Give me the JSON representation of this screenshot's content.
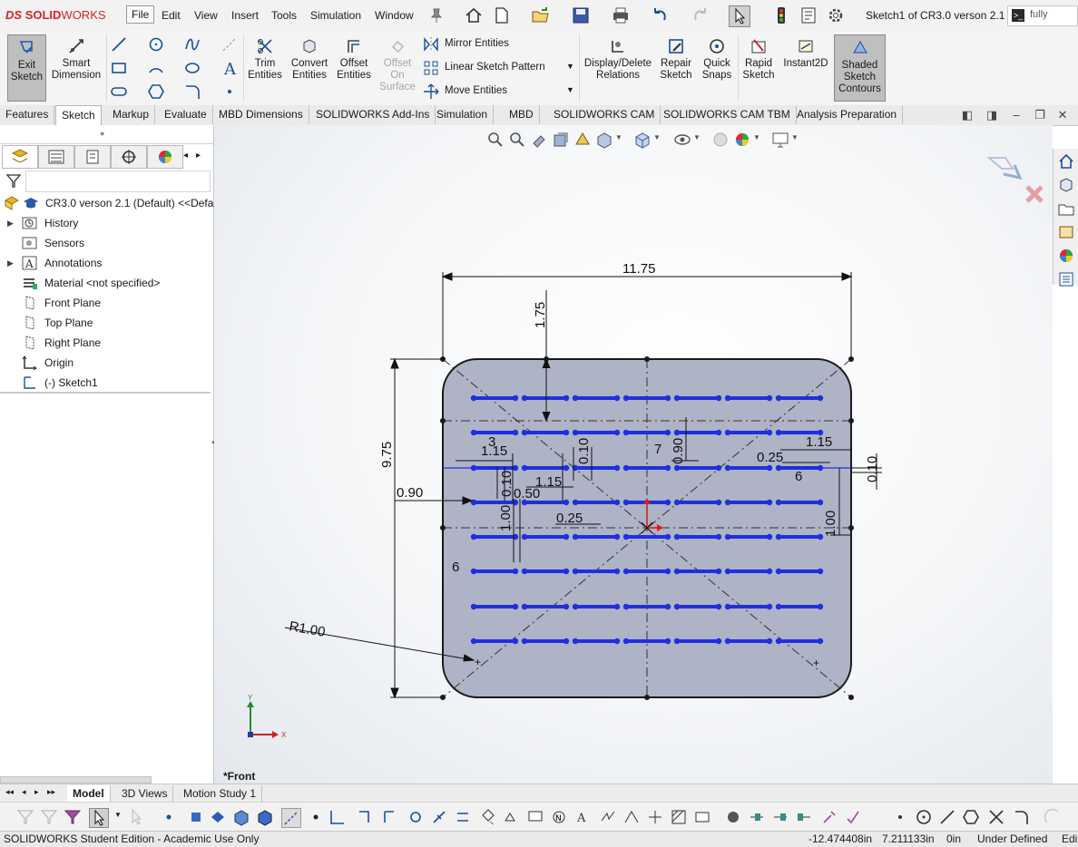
{
  "app": {
    "logo_prefix": "DS",
    "logo_bold": "SOLID",
    "logo_light": "WORKS",
    "document_title": "Sketch1 of CR3.0 verson 2.1 *",
    "search_text": "fully"
  },
  "menu": [
    "File",
    "Edit",
    "View",
    "Insert",
    "Tools",
    "Simulation",
    "Window"
  ],
  "command_manager": {
    "exit_sketch": "Exit Sketch",
    "smart_dimension": "Smart Dimension",
    "trim_entities": "Trim Entities",
    "convert_entities": "Convert Entities",
    "offset_entities": "Offset Entities",
    "offset_on_surface": "Offset On Surface",
    "mirror_entities": "Mirror Entities",
    "linear_sketch_pattern": "Linear Sketch Pattern",
    "move_entities": "Move Entities",
    "display_delete_relations": "Display/Delete Relations",
    "repair_sketch": "Repair Sketch",
    "quick_snaps": "Quick Snaps",
    "rapid_sketch": "Rapid Sketch",
    "instant2d": "Instant2D",
    "shaded_sketch_contours": "Shaded Sketch Contours"
  },
  "tabs": [
    "Features",
    "Sketch",
    "Markup",
    "Evaluate",
    "MBD Dimensions",
    "SOLIDWORKS Add-Ins",
    "Simulation",
    "MBD",
    "SOLIDWORKS CAM",
    "SOLIDWORKS CAM TBM",
    "Analysis Preparation"
  ],
  "active_tab": "Sketch",
  "feature_tree": {
    "root": "CR3.0 verson 2.1 (Default) <<Defau",
    "items": [
      "History",
      "Sensors",
      "Annotations",
      "Material <not specified>",
      "Front Plane",
      "Top Plane",
      "Right Plane",
      "Origin",
      "(-) Sketch1"
    ]
  },
  "sketch": {
    "dims": {
      "overall_width": "11.75",
      "overall_height": "9.75",
      "top_offset": "1.75",
      "left_offset": "0.90",
      "corner_radius": "R1.00",
      "d_1_15_a": "1.15",
      "d_3": "3",
      "d_0_10_a": "0.10",
      "d_0_10_b": "0.10",
      "d_1_15_b": "1.15",
      "d_0_50": "0.50",
      "d_1_00_a": "1.00",
      "d_0_25_a": "0.25",
      "d_7": "7",
      "d_0_90": "0.90",
      "d_0_25_b": "0.25",
      "d_1_15_c": "1.15",
      "d_6_a": "6",
      "d_0_10_c": "0.10",
      "d_1_00_b": "1.00",
      "d_6_b": "6"
    },
    "view_label": "*Front",
    "axis_x": "X",
    "axis_y": "Y",
    "colors": {
      "slot": "#1f2fe0",
      "fill": "#aeb3c6",
      "outline": "#1a1a1a",
      "origin": "#e01b1b"
    }
  },
  "bottom_tabs": [
    "Model",
    "3D Views",
    "Motion Study 1"
  ],
  "active_bottom_tab": "Model",
  "status": {
    "edition": "SOLIDWORKS Student Edition - Academic Use Only",
    "x_coord": "-12.474408in",
    "y_coord": "7.211133in",
    "z_coord": "0in",
    "state": "Under Defined",
    "mode": "Edi"
  }
}
